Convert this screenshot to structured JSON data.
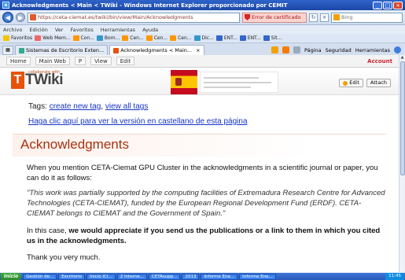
{
  "window": {
    "title": "Acknowledgments < Main < TWiki - Windows Internet Explorer proporcionado por CEMIT"
  },
  "address": {
    "url": "https://ceta-ciemat.es/twiki/bin/view/Main/Acknowledgments",
    "cert_error": "Error de certificado",
    "search_placeholder": "Bing"
  },
  "menu": [
    "Archivo",
    "Edición",
    "Ver",
    "Favoritos",
    "Herramientas",
    "Ayuda"
  ],
  "favorites": {
    "label": "Favoritos",
    "items": [
      "Web Mem...",
      "Con...",
      "Bom...",
      "Cen...",
      "Cen...",
      "Cen...",
      "Dic...",
      "ENT...",
      "ENT...",
      "Sit..."
    ]
  },
  "tabs": [
    {
      "label": "Sistemas de Escritorio Exten...",
      "active": false
    },
    {
      "label": "Acknowledgments < Main...",
      "active": true
    }
  ],
  "commandbar": [
    "Página",
    "Seguridad",
    "Herramientas"
  ],
  "twiki_nav": {
    "home": "Home",
    "web": "Main Web",
    "p": "P",
    "view": "View",
    "edit": "Edit",
    "account": "Account"
  },
  "logo": {
    "letter": "T",
    "word": "TWiki",
    "tagline": "collaborate with"
  },
  "edit_buttons": {
    "edit": "Edit",
    "attach": "Attach"
  },
  "tags": {
    "label": "Tags:",
    "create": "create new tag",
    "sep": ",",
    "view": "view all tags"
  },
  "castellano_link": "Haga clic aquí para ver la versión en castellano de esta página",
  "heading": "Acknowledgments",
  "paragraphs": {
    "p1": "When you mention CETA-Ciemat GPU Cluster in the acknowledgments in a scientific journal or paper, you can do it as follows:",
    "p2": "\"This work was partially supported by the computing facilities of Extremadura Research Centre for Advanced Technologies (CETA-CIEMAT), funded by the European Regional Development Fund (ERDF). CETA-CIEMAT belongs to CIEMAT and the Government of Spain.\"",
    "p3_prefix": "In this case, ",
    "p3_bold": "we would appreciate if you send us the publications or a link to them in which you cited us in the acknowledgments.",
    "p4": "Thank you very much."
  },
  "taskbar": {
    "start": "Inicio",
    "tasks": [
      "Gestión de...",
      "Escritorio",
      "Inicio ICI...",
      "2 Interne...",
      "CETAsupp...",
      "2013",
      "Informe Ene...",
      "Informe Ene..."
    ],
    "tray": "11:45"
  },
  "colors": {
    "heading": "#a7320f",
    "link": "#1534c7",
    "titlebar": "#2f64c9"
  }
}
